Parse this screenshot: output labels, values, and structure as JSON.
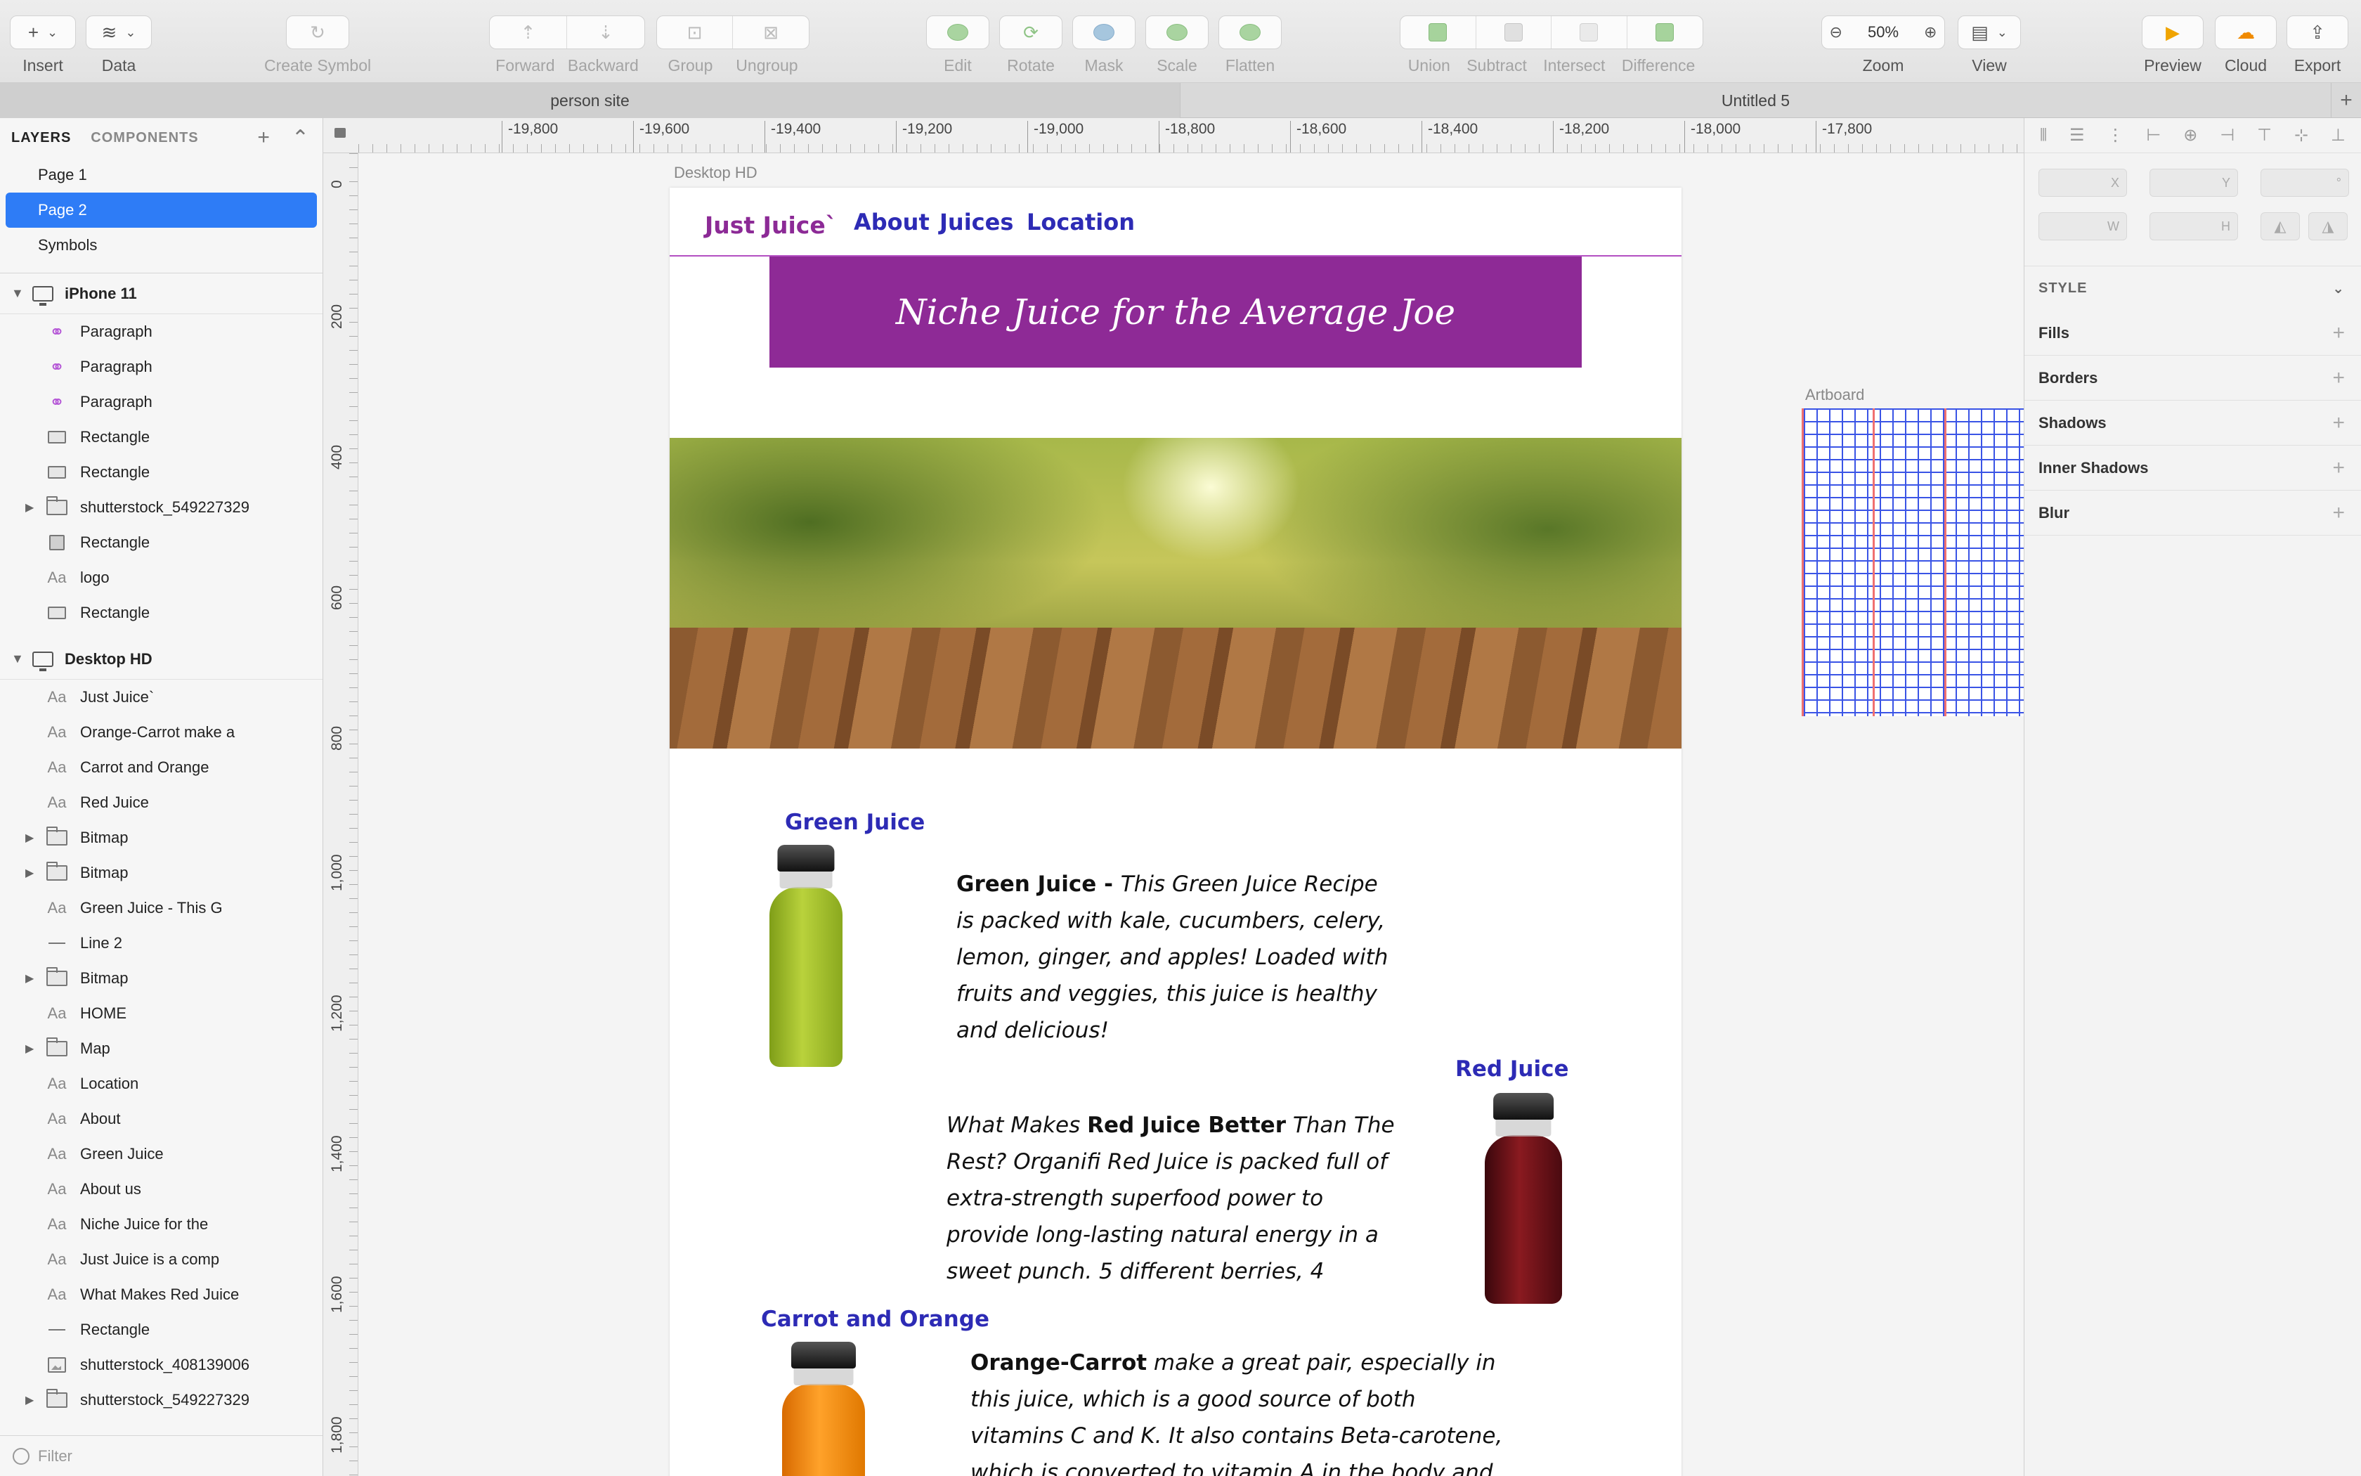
{
  "toolbar": {
    "insert": "Insert",
    "data": "Data",
    "create_symbol": "Create Symbol",
    "forward": "Forward",
    "backward": "Backward",
    "group": "Group",
    "ungroup": "Ungroup",
    "edit": "Edit",
    "rotate": "Rotate",
    "mask": "Mask",
    "scale": "Scale",
    "flatten": "Flatten",
    "union": "Union",
    "subtract": "Subtract",
    "intersect": "Intersect",
    "difference": "Difference",
    "zoom_label": "Zoom",
    "zoom_value": "50%",
    "view": "View",
    "preview": "Preview",
    "cloud": "Cloud",
    "export": "Export"
  },
  "tabs": [
    "person site",
    "Untitled 5"
  ],
  "layers_panel": {
    "tab_layers": "LAYERS",
    "tab_components": "COMPONENTS",
    "pages": [
      "Page 1",
      "Page 2",
      "Symbols"
    ],
    "selected_page": "Page 2",
    "groups": [
      {
        "name": "iPhone 11",
        "layers": [
          {
            "name": "Paragraph",
            "icon": "symbol-icon",
            "expandable": false
          },
          {
            "name": "Paragraph",
            "icon": "symbol-icon",
            "expandable": false
          },
          {
            "name": "Paragraph",
            "icon": "symbol-icon",
            "expandable": false
          },
          {
            "name": "Rectangle",
            "icon": "rectangle-icon",
            "expandable": false
          },
          {
            "name": "Rectangle",
            "icon": "rectangle-icon",
            "expandable": false
          },
          {
            "name": "shutterstock_549227329",
            "icon": "folder-icon",
            "expandable": true
          },
          {
            "name": "Rectangle",
            "icon": "rectangle-filled-icon",
            "expandable": false
          },
          {
            "name": "logo",
            "icon": "text-icon",
            "expandable": false
          },
          {
            "name": "Rectangle",
            "icon": "rectangle-icon",
            "expandable": false
          }
        ]
      },
      {
        "name": "Desktop HD",
        "layers": [
          {
            "name": "Just Juice`",
            "icon": "text-icon",
            "expandable": false
          },
          {
            "name": "Orange-Carrot make a",
            "icon": "text-icon",
            "expandable": false
          },
          {
            "name": "Carrot and Orange",
            "icon": "text-icon",
            "expandable": false
          },
          {
            "name": "Red Juice",
            "icon": "text-icon",
            "expandable": false
          },
          {
            "name": "Bitmap",
            "icon": "folder-icon",
            "expandable": true
          },
          {
            "name": "Bitmap",
            "icon": "folder-icon",
            "expandable": true
          },
          {
            "name": "Green Juice - This G",
            "icon": "text-icon",
            "expandable": false
          },
          {
            "name": "Line 2",
            "icon": "line-icon",
            "expandable": false
          },
          {
            "name": "Bitmap",
            "icon": "folder-icon",
            "expandable": true
          },
          {
            "name": "HOME",
            "icon": "text-icon",
            "expandable": false
          },
          {
            "name": "Map",
            "icon": "folder-icon",
            "expandable": true
          },
          {
            "name": "Location",
            "icon": "text-icon",
            "expandable": false
          },
          {
            "name": "About",
            "icon": "text-icon",
            "expandable": false
          },
          {
            "name": "Green Juice",
            "icon": "text-icon",
            "expandable": false
          },
          {
            "name": "About us",
            "icon": "text-icon",
            "expandable": false
          },
          {
            "name": "Niche Juice for the",
            "icon": "text-icon",
            "expandable": false
          },
          {
            "name": "Just Juice is a comp",
            "icon": "text-icon",
            "expandable": false
          },
          {
            "name": "What Makes Red Juice",
            "icon": "text-icon",
            "expandable": false
          },
          {
            "name": "Rectangle",
            "icon": "line-icon",
            "expandable": false
          },
          {
            "name": "shutterstock_408139006",
            "icon": "image-icon",
            "expandable": false
          },
          {
            "name": "shutterstock_549227329",
            "icon": "folder-icon",
            "expandable": true
          }
        ]
      }
    ],
    "filter_placeholder": "Filter"
  },
  "rulers": {
    "top": [
      "-19,800",
      "-19,600",
      "-19,400",
      "-19,200",
      "-19,000",
      "-18,800",
      "-18,600",
      "-18,400",
      "-18,200",
      "-18,000",
      "-17,800"
    ],
    "left": [
      "0",
      "200",
      "400",
      "600",
      "800",
      "1,000",
      "1,200",
      "1,400",
      "1,600",
      "1,800"
    ]
  },
  "canvas": {
    "artboard_name": "Desktop HD",
    "second_artboard_name": "Artboard",
    "site": {
      "logo": "Just Juice`",
      "nav": [
        "About",
        "Juices",
        "Location"
      ],
      "tagline": "Niche Juice for the Average Joe",
      "green": {
        "title": "Green Juice",
        "lead": "Green Juice - ",
        "text": "This Green Juice Recipe is packed with kale, cucumbers, celery, lemon, ginger, and apples! Loaded with fruits and veggies, this juice is healthy and delicious!"
      },
      "red": {
        "title": "Red   Juice",
        "pre": "What Makes ",
        "bold": "Red Juice Better",
        "text": " Than The Rest? Organifi Red Juice is packed full of extra-strength superfood power to provide long-lasting natural energy in a sweet punch. 5 different berries, 4"
      },
      "carrot": {
        "title": "Carrot and Orange",
        "lead": "Orange-Carrot",
        "text": " make a great pair, especially in this juice, which is a good source of both vitamins C and K. It also contains Beta-carotene, which is converted to vitamin A in the body and for skin and eye health. Be"
      }
    }
  },
  "inspector": {
    "x_label": "X",
    "y_label": "Y",
    "angle_label": "°",
    "w_label": "W",
    "h_label": "H",
    "style": "STYLE",
    "sections": [
      "Fills",
      "Borders",
      "Shadows",
      "Inner Shadows",
      "Blur"
    ]
  },
  "colors": {
    "accent": "#2e7cf6",
    "site_purple": "#8e2a96",
    "site_blue": "#2d2bb5"
  }
}
